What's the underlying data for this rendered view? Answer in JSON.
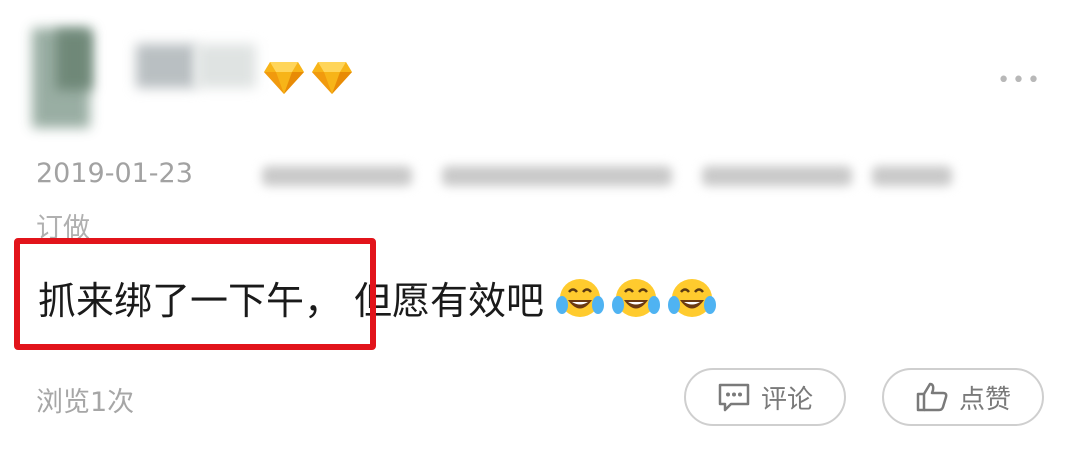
{
  "post": {
    "timestamp": "2019-01-23",
    "meta_line2": "订做",
    "message_highlighted": "抓来绑了一下午，",
    "message_rest": "但愿有效吧",
    "emoji": [
      "laughing-crying-emoji",
      "laughing-crying-emoji",
      "laughing-crying-emoji"
    ],
    "badges": [
      "diamond-icon",
      "diamond-icon"
    ],
    "views": "浏览1次"
  },
  "actions": {
    "comment_label": "评论",
    "like_label": "点赞"
  },
  "colors": {
    "highlight_border": "#e2141b",
    "badge_gold": "#f6b21a",
    "meta_text": "#a2a2a2"
  }
}
